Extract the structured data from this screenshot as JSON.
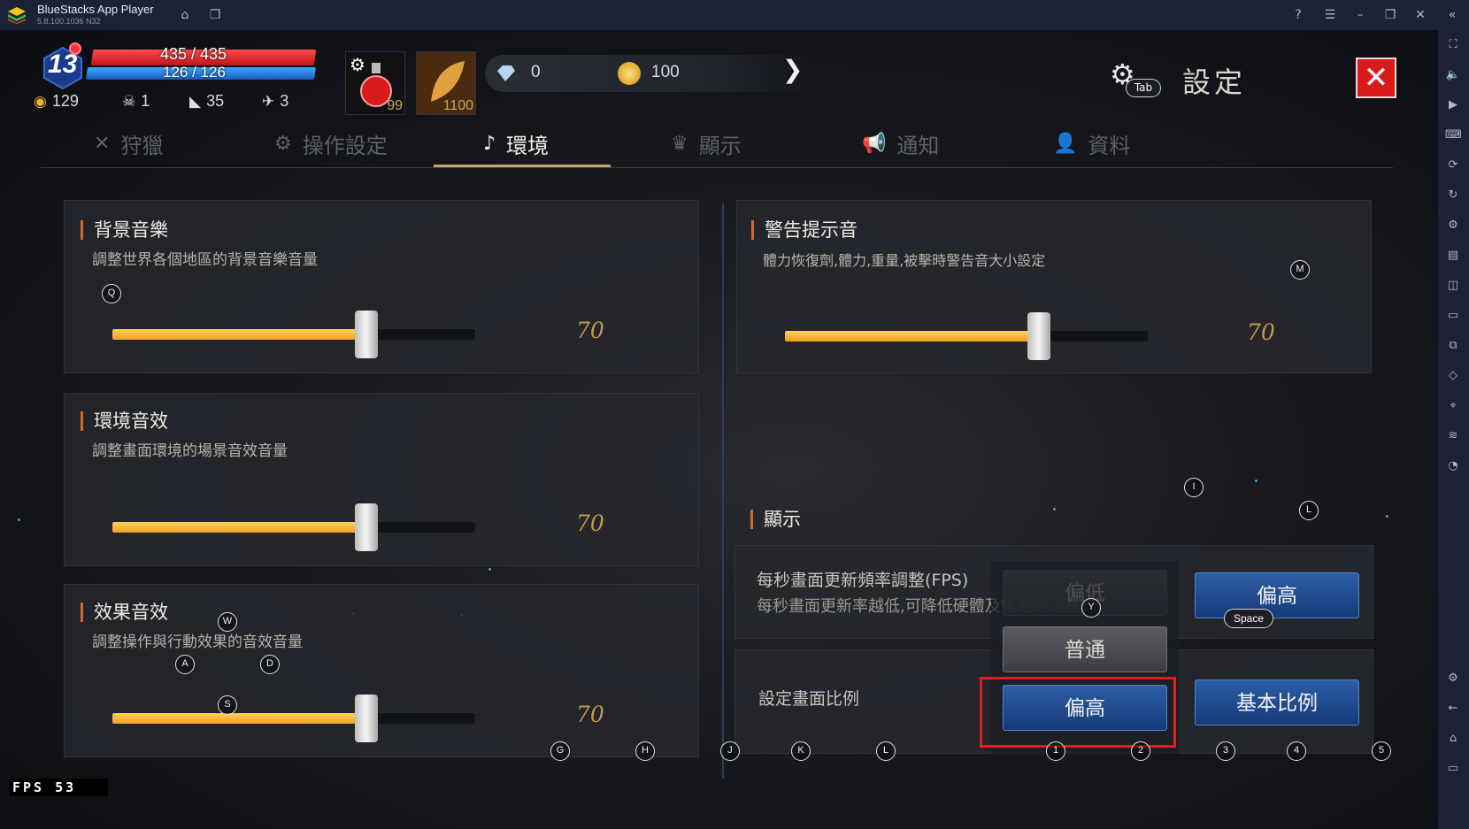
{
  "app": {
    "title": "BlueStacks App Player",
    "version": "5.8.100.1036 N32"
  },
  "titlebar_icons": [
    "home-icon",
    "multi-window-icon",
    "help-icon",
    "menu-icon",
    "minimize-icon",
    "restore-icon",
    "close-icon",
    "collapse-icon"
  ],
  "hud": {
    "level": "13",
    "hp": "435 / 435",
    "mp": "126 / 126",
    "stats": [
      "129",
      "1",
      "35",
      "3"
    ],
    "potion_count": "99",
    "leaf_count": "1100",
    "diamonds": "0",
    "gold": "100"
  },
  "header": {
    "settings_title": "設定",
    "tab_key": "Tab"
  },
  "tabs": [
    {
      "label": "狩獵",
      "icon": "swords-icon"
    },
    {
      "label": "操作設定",
      "icon": "gear-icon"
    },
    {
      "label": "環境",
      "icon": "music-note-icon"
    },
    {
      "label": "顯示",
      "icon": "display-icon"
    },
    {
      "label": "通知",
      "icon": "megaphone-icon"
    },
    {
      "label": "資料",
      "icon": "profile-icon"
    }
  ],
  "active_tab": "環境",
  "left": {
    "bgm": {
      "title": "背景音樂",
      "desc": "調整世界各個地區的背景音樂音量",
      "value": "70",
      "level": 0.7
    },
    "env": {
      "title": "環境音效",
      "desc": "調整畫面環境的場景音效音量",
      "value": "70",
      "level": 0.7
    },
    "fx": {
      "title": "效果音效",
      "desc": "調整操作與行動效果的音效音量",
      "value": "70",
      "level": 0.7
    }
  },
  "right": {
    "warn": {
      "title": "警告提示音",
      "desc": "體力恢復劑,體力,重量,被擊時警告音大小設定",
      "value": "70",
      "level": 0.7
    },
    "display": {
      "title": "顯示"
    },
    "fps": {
      "label": "每秒畫面更新頻率調整(FPS)",
      "desc": "每秒畫面更新率越低,可降低硬體及電池的消耗量",
      "low": "偏低",
      "high": "偏高"
    },
    "dropdown": {
      "normal": "普通",
      "high": "偏高"
    },
    "ratio": {
      "label": "設定畫面比例",
      "basic": "基本比例"
    }
  },
  "keyhints": {
    "q": "Q",
    "w": "W",
    "a": "A",
    "d": "D",
    "s": "S",
    "m": "M",
    "i": "I",
    "l": "L",
    "y": "Y",
    "space": "Space",
    "bottom": [
      "G",
      "H",
      "J",
      "K",
      "L",
      "1",
      "2",
      "3",
      "4",
      "5"
    ]
  },
  "fps_counter": "FPS   53",
  "colors": {
    "accent_gold": "#c49a46",
    "slider_fill": "#f0a020",
    "selected_blue": "#2c5ea6",
    "highlight_red": "#e02020",
    "close_red": "#d81c1c"
  }
}
